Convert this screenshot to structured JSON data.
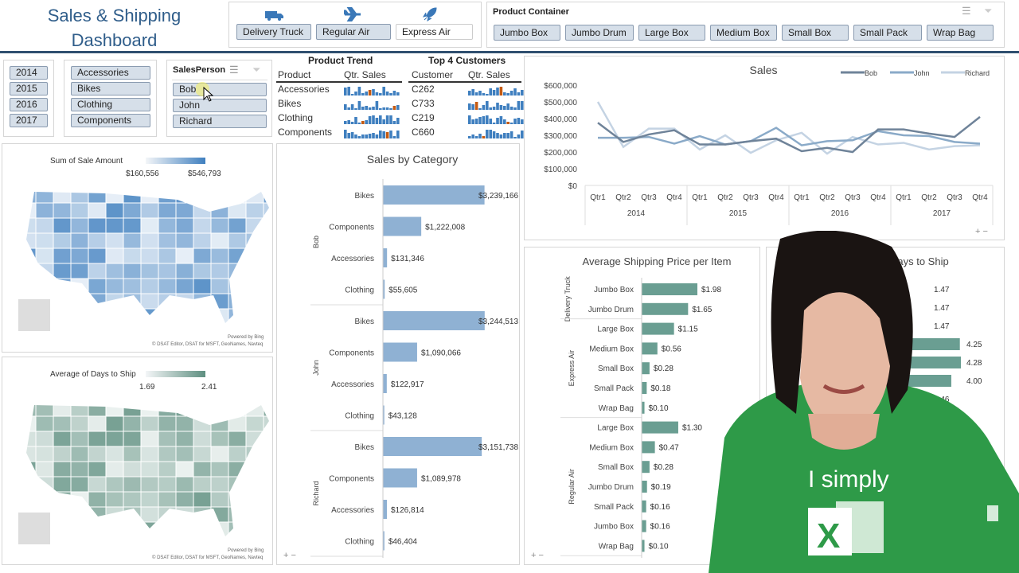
{
  "header": {
    "title_line1": "Sales & Shipping",
    "title_line2": "Dashboard"
  },
  "ship_mode_slicer": {
    "items": [
      {
        "label": "Delivery Truck",
        "icon": "truck-icon",
        "selected": true
      },
      {
        "label": "Regular Air",
        "icon": "airplane-icon",
        "selected": true
      },
      {
        "label": "Express Air",
        "icon": "rocket-icon",
        "selected": false
      }
    ]
  },
  "product_container_slicer": {
    "title": "Product Container",
    "items": [
      "Jumbo Box",
      "Jumbo Drum",
      "Large Box",
      "Medium Box",
      "Small Box",
      "Small Pack",
      "Wrap Bag"
    ]
  },
  "year_slicer": {
    "items": [
      "2014",
      "2015",
      "2016",
      "2017"
    ]
  },
  "category_slicer": {
    "items": [
      "Accessories",
      "Bikes",
      "Clothing",
      "Components"
    ]
  },
  "salesperson_slicer": {
    "title": "SalesPerson",
    "items": [
      "Bob",
      "John",
      "Richard"
    ]
  },
  "product_trend": {
    "title": "Product Trend",
    "col1": "Product",
    "col2": "Qtr. Sales",
    "rows": [
      "Accessories",
      "Bikes",
      "Clothing",
      "Components"
    ]
  },
  "top_customers": {
    "title": "Top 4 Customers",
    "col1": "Customer",
    "col2": "Qtr. Sales",
    "rows": [
      "C262",
      "C733",
      "C219",
      "C660"
    ]
  },
  "map_sales": {
    "legend_title": "Sum of Sale Amount",
    "min": "$160,556",
    "max": "$546,793",
    "powered": "Powered by Bing",
    "credit": "© DSAT Editor, DSAT for MSFT, GeoNames, Navteq",
    "color": "#3f7fbf"
  },
  "map_days": {
    "legend_title": "Average of Days to Ship",
    "min": "1.69",
    "max": "2.41",
    "powered": "Powered by Bing",
    "credit": "© DSAT Editor, DSAT for MSFT, GeoNames, Navteq",
    "color": "#5e8f80"
  },
  "chart_data": [
    {
      "type": "line",
      "title": "Sales",
      "categories": [
        "Qtr1",
        "Qtr2",
        "Qtr3",
        "Qtr4",
        "Qtr1",
        "Qtr2",
        "Qtr3",
        "Qtr4",
        "Qtr1",
        "Qtr2",
        "Qtr3",
        "Qtr4",
        "Qtr1",
        "Qtr2",
        "Qtr3",
        "Qtr4"
      ],
      "years": [
        "2014",
        "2015",
        "2016",
        "2017"
      ],
      "yticks": [
        "$0",
        "$100,000",
        "$200,000",
        "$300,000",
        "$400,000",
        "$500,000",
        "$600,000"
      ],
      "ylim": [
        0,
        600000
      ],
      "legend": "top-right",
      "series": [
        {
          "name": "Bob",
          "color": "#6f8399",
          "values": [
            375000,
            260000,
            305000,
            330000,
            245000,
            245000,
            265000,
            280000,
            205000,
            225000,
            200000,
            335000,
            335000,
            310000,
            290000,
            410000
          ]
        },
        {
          "name": "John",
          "color": "#8aaac8",
          "values": [
            285000,
            285000,
            290000,
            250000,
            295000,
            245000,
            265000,
            345000,
            240000,
            265000,
            270000,
            325000,
            300000,
            295000,
            260000,
            250000
          ]
        },
        {
          "name": "Richard",
          "color": "#c4d3e3",
          "values": [
            500000,
            230000,
            340000,
            340000,
            215000,
            300000,
            195000,
            270000,
            315000,
            190000,
            290000,
            245000,
            255000,
            215000,
            235000,
            240000
          ]
        }
      ]
    },
    {
      "type": "bar",
      "title": "Sales by Category",
      "groups": [
        {
          "name": "Bob",
          "categories": [
            "Bikes",
            "Components",
            "Accessories",
            "Clothing"
          ],
          "values": [
            3239166,
            1222008,
            131346,
            55605
          ],
          "labels": [
            "$3,239,166",
            "$1,222,008",
            "$131,346",
            "$55,605"
          ]
        },
        {
          "name": "John",
          "categories": [
            "Bikes",
            "Components",
            "Accessories",
            "Clothing"
          ],
          "values": [
            3244513,
            1090066,
            122917,
            43128
          ],
          "labels": [
            "$3,244,513",
            "$1,090,066",
            "$122,917",
            "$43,128"
          ]
        },
        {
          "name": "Richard",
          "categories": [
            "Bikes",
            "Components",
            "Accessories",
            "Clothing"
          ],
          "values": [
            3151738,
            1089978,
            126814,
            46404
          ],
          "labels": [
            "$3,151,738",
            "$1,089,978",
            "$126,814",
            "$46,404"
          ]
        }
      ],
      "color": "#8fb1d3"
    },
    {
      "type": "bar",
      "title": "Average Shipping Price per Item",
      "groups": [
        {
          "name": "Delivery Truck",
          "categories": [
            "Jumbo Box",
            "Jumbo Drum"
          ],
          "values": [
            1.98,
            1.65
          ],
          "labels": [
            "$1.98",
            "$1.65"
          ]
        },
        {
          "name": "Express Air",
          "categories": [
            "Large Box",
            "Medium Box",
            "Small Box",
            "Small Pack",
            "Wrap Bag"
          ],
          "values": [
            1.15,
            0.56,
            0.28,
            0.18,
            0.1
          ],
          "labels": [
            "$1.15",
            "$0.56",
            "$0.28",
            "$0.18",
            "$0.10"
          ]
        },
        {
          "name": "Regular Air",
          "categories": [
            "Large Box",
            "Medium Box",
            "Small Box",
            "Jumbo Drum",
            "Small Pack",
            "Jumbo Box",
            "Wrap Bag"
          ],
          "values": [
            1.3,
            0.47,
            0.28,
            0.19,
            0.16,
            0.16,
            0.1
          ],
          "labels": [
            "$1.30",
            "$0.47",
            "$0.28",
            "$0.19",
            "$0.16",
            "$0.16",
            "$0.10"
          ]
        }
      ],
      "color": "#6a9e92"
    },
    {
      "type": "bar",
      "title": "Days to Ship",
      "values": [
        1.47,
        1.47,
        1.47,
        4.25,
        4.28,
        4.0,
        1.46
      ],
      "labels": [
        "1.47",
        "1.47",
        "1.47",
        "4.25",
        "4.28",
        "4.00",
        "1.46"
      ],
      "color": "#6a9e92"
    }
  ],
  "presenter": {
    "shirt_text": "I simply",
    "logo": "X",
    "shirt_color": "#2e9a48"
  },
  "zoom_controls": {
    "plus": "+",
    "minus": "−"
  }
}
